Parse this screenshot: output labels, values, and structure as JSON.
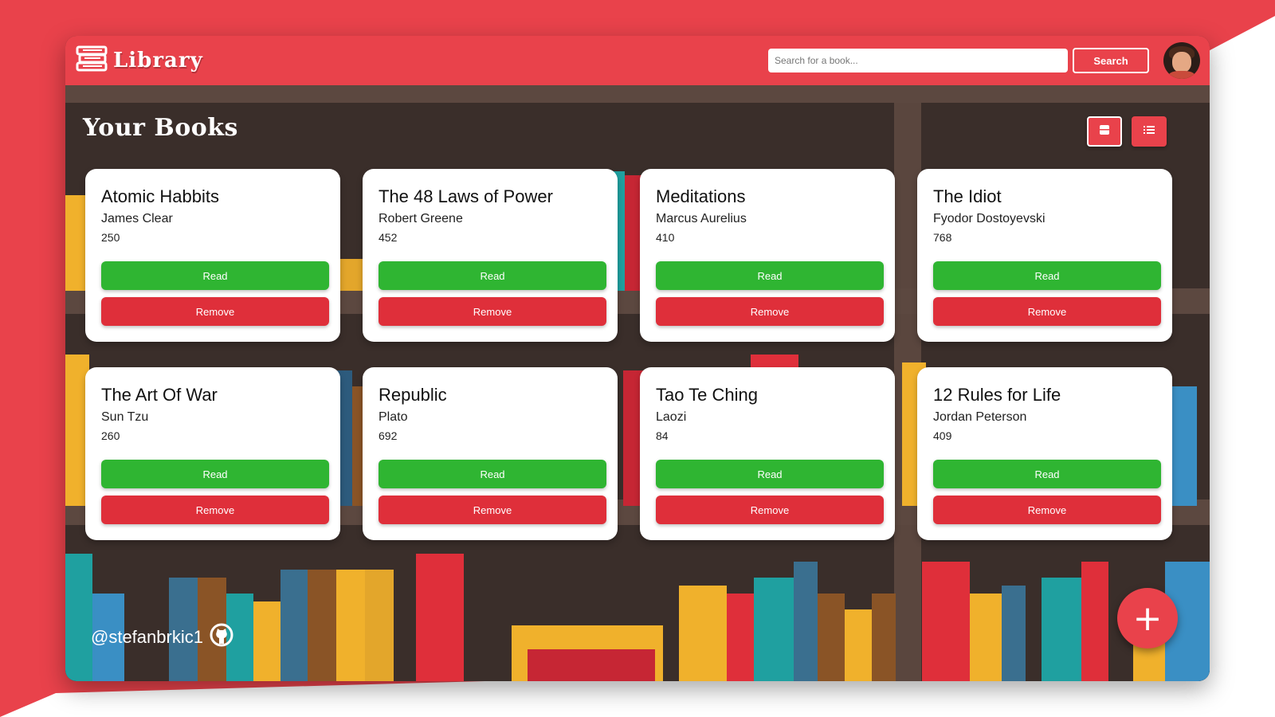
{
  "app": {
    "name": "Library"
  },
  "search": {
    "placeholder": "Search for a book...",
    "button_label": "Search"
  },
  "page": {
    "title": "Your Books"
  },
  "books": [
    {
      "title": "Atomic Habbits",
      "author": "James Clear",
      "pages": "250"
    },
    {
      "title": "The 48 Laws of Power",
      "author": "Robert Greene",
      "pages": "452"
    },
    {
      "title": "Meditations",
      "author": "Marcus Aurelius",
      "pages": "410"
    },
    {
      "title": "The Idiot",
      "author": "Fyodor Dostoyevski",
      "pages": "768"
    },
    {
      "title": "The Art Of War",
      "author": "Sun Tzu",
      "pages": "260"
    },
    {
      "title": "Republic",
      "author": "Plato",
      "pages": "692"
    },
    {
      "title": "Tao Te Ching",
      "author": "Laozi",
      "pages": "84"
    },
    {
      "title": "12 Rules for Life",
      "author": "Jordan Peterson",
      "pages": "409"
    }
  ],
  "card_actions": {
    "read_label": "Read",
    "remove_label": "Remove"
  },
  "footer": {
    "github_handle": "@stefanbrkic1"
  },
  "fab": {
    "label": "+"
  },
  "icons": {
    "logo": "books-stack-icon",
    "grid_view": "grid-icon",
    "list_view": "list-icon",
    "github": "github-icon",
    "add": "plus-icon"
  },
  "colors": {
    "brand_red": "#e9424b",
    "read_green": "#2fb532",
    "remove_red": "#df2f3a",
    "shelf_brown": "#3a2e2a"
  }
}
